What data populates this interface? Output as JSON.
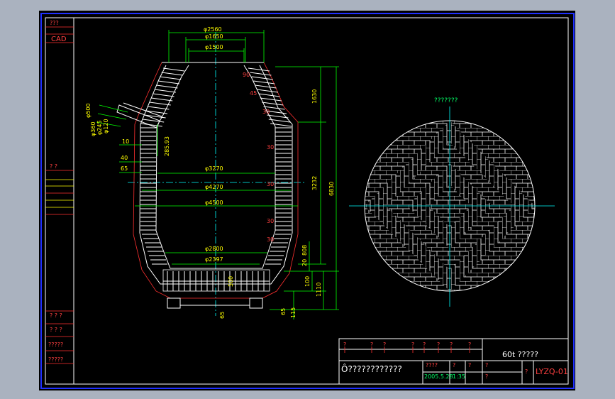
{
  "side_labels": {
    "top": "???",
    "cad": "CAD",
    "mid": "?   ?",
    "b1": "? ? ?",
    "b2": "? ? ?",
    "b3": "?????",
    "b4": "?????"
  },
  "section_view": {
    "diam_top_outer": "φ2560",
    "diam_top_mid": "φ1650",
    "diam_top_inner": "φ1500",
    "diam_body_1": "φ3270",
    "diam_body_2": "φ4270",
    "diam_body_3": "φ4500",
    "diam_bottom_1": "φ2800",
    "diam_bottom_2": "φ2397",
    "dim_1630": "1630",
    "dim_3232": "3232",
    "dim_6830": "6830",
    "dim_808": "808",
    "dim_20": "20",
    "dim_100": "100",
    "dim_1110": "1110",
    "dim_500": "500",
    "dim_65_a": "65",
    "dim_65_b": "65",
    "dim_115": "115",
    "dim_28593": "285.93",
    "left_10": "10",
    "left_40": "40",
    "left_65": "65",
    "tap_500": "φ500",
    "tap_360": "φ360",
    "tap_245": "φ245",
    "tap_120": "φ120",
    "zone_numbers": [
      "90",
      "45",
      "30",
      "30",
      "30",
      "30",
      "30"
    ]
  },
  "plan_view": {
    "title": "???????"
  },
  "title_block": {
    "drawing_title": "60t ?????",
    "description": "Ô????????????",
    "date": "2005.5.28",
    "scale": "1:35",
    "sheet_code": "LYZQ-01",
    "label_a": "????",
    "label_b": "?",
    "label_c": "?",
    "header_marks": [
      "?",
      "?",
      "?",
      "?",
      "?",
      "?",
      "?",
      "?"
    ]
  }
}
